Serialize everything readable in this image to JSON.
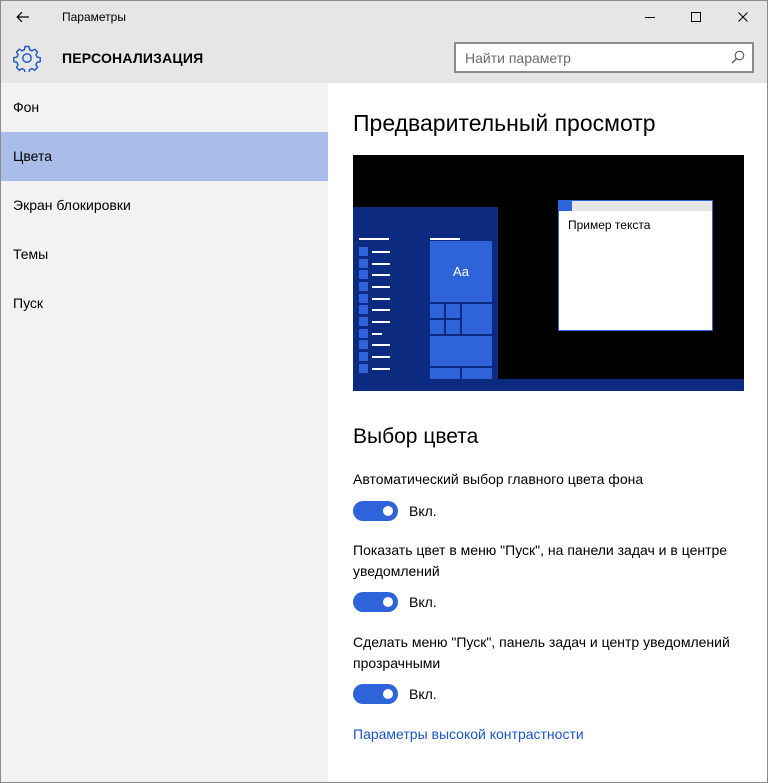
{
  "window": {
    "title": "Параметры"
  },
  "header": {
    "title": "ПЕРСОНАЛИЗАЦИЯ",
    "search_placeholder": "Найти параметр"
  },
  "sidebar": {
    "items": [
      {
        "label": "Фон",
        "selected": false
      },
      {
        "label": "Цвета",
        "selected": true
      },
      {
        "label": "Экран блокировки",
        "selected": false
      },
      {
        "label": "Темы",
        "selected": false
      },
      {
        "label": "Пуск",
        "selected": false
      }
    ]
  },
  "main": {
    "preview_heading": "Предварительный просмотр",
    "preview": {
      "tile_label": "Aa",
      "sample_text": "Пример текста"
    },
    "color_heading": "Выбор цвета",
    "settings": [
      {
        "label": "Автоматический выбор главного цвета фона",
        "state": "Вкл.",
        "on": true
      },
      {
        "label": "Показать цвет в меню \"Пуск\", на панели задач и в центре уведомлений",
        "state": "Вкл.",
        "on": true
      },
      {
        "label": "Сделать меню \"Пуск\", панель задач и центр уведомлений прозрачными",
        "state": "Вкл.",
        "on": true
      }
    ],
    "high_contrast_link": "Параметры высокой контрастности"
  },
  "colors": {
    "accent": "#2f63d9",
    "start_background": "#0b2a80",
    "selected_nav": "#a9bde8",
    "chrome": "#e6e6e6",
    "sidebar": "#f2f2f2",
    "link": "#1a56c8"
  },
  "icons": {
    "back": "arrow-left-icon",
    "minimize": "minimize-icon",
    "maximize": "maximize-icon",
    "close": "close-icon",
    "section": "gear-icon",
    "search": "search-icon"
  }
}
